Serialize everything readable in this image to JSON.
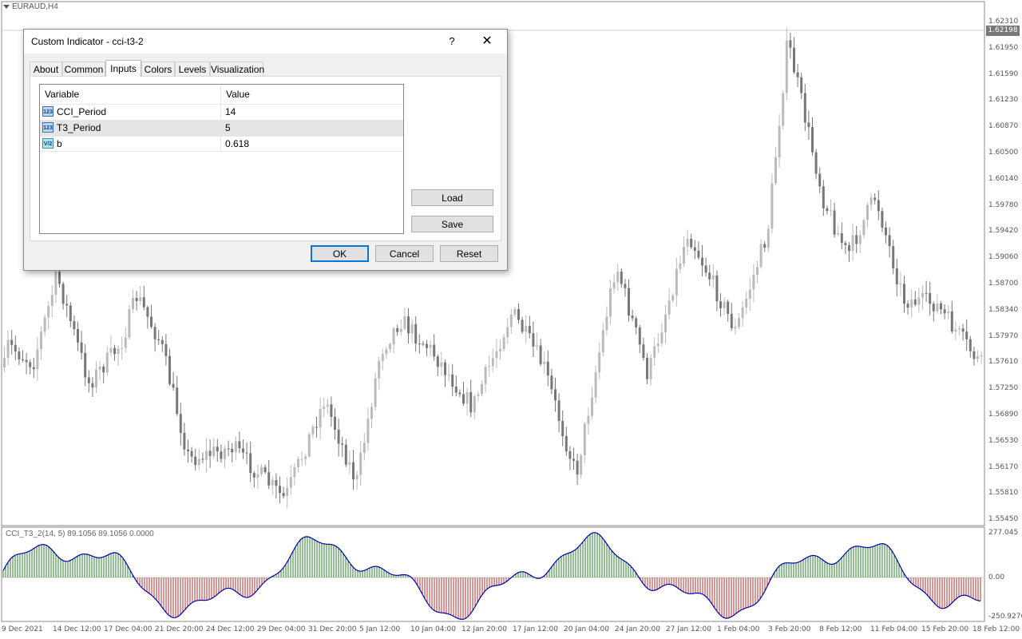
{
  "chart": {
    "symbol": "EURAUD,H4",
    "current_price": "1.62198",
    "price_ticks": [
      "1.62310",
      "1.61950",
      "1.61590",
      "1.61230",
      "1.60870",
      "1.60500",
      "1.60140",
      "1.59780",
      "1.59420",
      "1.59060",
      "1.58700",
      "1.58340",
      "1.57970",
      "1.57610",
      "1.57250",
      "1.56890",
      "1.56530",
      "1.56170",
      "1.55810",
      "1.55450"
    ],
    "time_ticks": [
      "9 Dec 2021",
      "14 Dec 12:00",
      "17 Dec 04:00",
      "21 Dec 20:00",
      "24 Dec 12:00",
      "29 Dec 04:00",
      "31 Dec 20:00",
      "5 Jan 12:00",
      "10 Jan 04:00",
      "12 Jan 20:00",
      "17 Jan 12:00",
      "20 Jan 04:00",
      "24 Jan 20:00",
      "27 Jan 12:00",
      "1 Feb 04:00",
      "3 Feb 20:00",
      "8 Feb 12:00",
      "11 Feb 04:00",
      "15 Feb 20:00",
      "18 Feb 12:00"
    ],
    "indicator_label": "CCI_T3_2(14, 5) 89.1056 89.1056 0.0000",
    "indicator_ticks": [
      "277.045",
      "0.00",
      "-250.9276"
    ],
    "colors": {
      "bull": "#bbbbbb",
      "bear": "#777777",
      "pos_hist": "#2e7d2e",
      "neg_hist": "#b03030",
      "line": "#0000aa"
    }
  },
  "dialog": {
    "title": "Custom Indicator - cci-t3-2",
    "help": "?",
    "close": "✕",
    "tabs": [
      "About",
      "Common",
      "Inputs",
      "Colors",
      "Levels",
      "Visualization"
    ],
    "active_tab": "Inputs",
    "table": {
      "headers": [
        "Variable",
        "Value"
      ],
      "rows": [
        {
          "icon": "123",
          "variable": "CCI_Period",
          "value": "14"
        },
        {
          "icon": "123",
          "variable": "T3_Period",
          "value": "5"
        },
        {
          "icon": "V/2",
          "variable": "b",
          "value": "0.618"
        }
      ]
    },
    "buttons": {
      "load": "Load",
      "save": "Save",
      "ok": "OK",
      "cancel": "Cancel",
      "reset": "Reset"
    }
  }
}
